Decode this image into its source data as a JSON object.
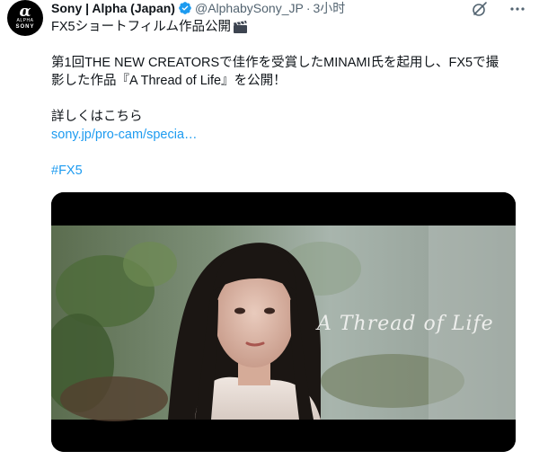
{
  "author": {
    "display_name": "Sony | Alpha (Japan)",
    "handle": "@AlphabySony_JP",
    "separator": "·",
    "time": "3小时",
    "avatar": {
      "glyph": "α",
      "alpha_label": "ALPHA",
      "brand_label": "SONY"
    }
  },
  "tweet": {
    "line1": "FX5ショートフィルム作品公開",
    "line2": "第1回THE NEW CREATORSで佳作を受賞したMINAMI氏を起用し、FX5で撮",
    "line3": "影した作品『A Thread of Life』を公開！",
    "line4": "詳しくはこちら",
    "link": "sony.jp/pro-cam/specia…",
    "hashtag": "#FX5"
  },
  "media": {
    "overlay_title": "A Thread of Life"
  },
  "colors": {
    "link": "#1d9bf0",
    "verified": "#1d9bf0",
    "muted": "#536471",
    "text": "#0f1419"
  },
  "icons": {
    "verified": "verified-badge-icon",
    "grok": "grok-icon",
    "more": "more-options-icon",
    "clapper": "clapper-board-emoji-icon"
  }
}
